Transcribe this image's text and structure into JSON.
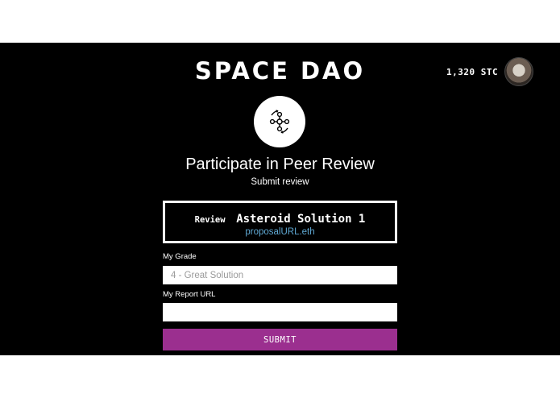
{
  "header": {
    "logo_text": "SPACE DAO",
    "balance": "1,320 STC",
    "avatar_icon": "user-avatar"
  },
  "hero": {
    "icon": "network-cycle-icon",
    "title": "Participate in Peer Review",
    "subtitle": "Submit review"
  },
  "review": {
    "label": "Review",
    "name": "Asteroid Solution 1",
    "link": "proposalURL.eth"
  },
  "form": {
    "grade_label": "My Grade",
    "grade_placeholder": "4 - Great Solution",
    "report_label": "My Report URL",
    "report_placeholder": "",
    "submit_label": "SUBMIT"
  },
  "colors": {
    "background": "#000000",
    "accent": "#9b2f8f",
    "link": "#5fa8d3"
  }
}
